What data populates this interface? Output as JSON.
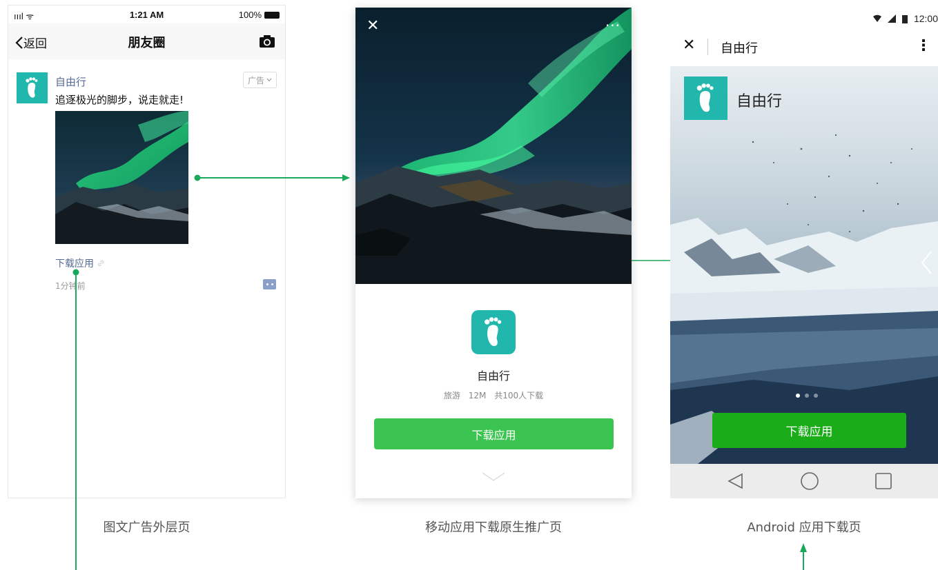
{
  "colors": {
    "accent_green": "#3cc451",
    "android_green": "#1aad19",
    "link_blue": "#576b95",
    "brand_teal": "#22b7ad",
    "connector": "#1aa85a"
  },
  "moments": {
    "status": {
      "signal": "ıııl ᯤ",
      "time": "1:21 AM",
      "battery": "100%"
    },
    "nav": {
      "back_label": "返回",
      "title": "朋友圈",
      "camera_icon": "camera-icon"
    },
    "post": {
      "advertiser": "自由行",
      "ad_badge": "广告",
      "text": "追逐极光的脚步，说走就走!",
      "link_label": "下载应用",
      "time": "1分钟前"
    }
  },
  "native": {
    "close_label": "✕",
    "more_label": "···",
    "app_name": "自由行",
    "meta": [
      "旅游",
      "12M",
      "共100人下载"
    ],
    "download_label": "下载应用"
  },
  "android": {
    "status_time": "12:00",
    "close_label": "✕",
    "title": "自由行",
    "kebab_label": "⋮",
    "app_name": "自由行",
    "download_label": "下载应用"
  },
  "captions": {
    "moments": "图文广告外层页",
    "native": "移动应用下载原生推广页",
    "android": "Android 应用下载页"
  }
}
